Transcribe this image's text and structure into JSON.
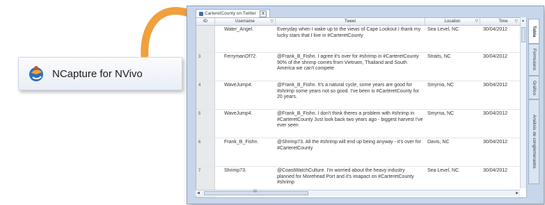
{
  "ncapture": {
    "label": "NCapture for NVivo",
    "icon": "ncapture-logo-icon"
  },
  "window": {
    "tab_title": "CarteretCounty on Twitter",
    "tab_close": "x"
  },
  "grid": {
    "columns": {
      "id": "ID",
      "username": "Username",
      "tweet": "Tweet",
      "location": "Location",
      "time": "Time"
    },
    "filter_glyph": "▽",
    "rows": [
      {
        "num": "",
        "username": "Water_Angel.",
        "tweet": "Everyday when I wake up to the views of Cape Lookout I thank my lucky stars that I live in #CarteretCounty",
        "location": "Sea Level, NC",
        "time": "30/04/2012"
      },
      {
        "num": "3",
        "username": "FerrymanOf72.",
        "tweet": "@Frank_B_Fishn. I agree it's over for #shrimp in #CarteretCounty 90% of the shrimp comes from Vietnam, Thailand and South America we can't compete",
        "location": "Straits, NC",
        "time": "30/04/2012"
      },
      {
        "num": "4",
        "username": "WaveJump4.",
        "tweet": "@Frank_B_Fishn. It's a natural cycle, some years are good for #shrimp some years not so good. I've been is #CarteretCounty for 20 years.",
        "location": "Smyrna, NC",
        "time": "30/04/2012"
      },
      {
        "num": "5",
        "username": "WaveJump4.",
        "tweet": "@Frank_B_Fishn. I don't think theres a problem with #shrimp in #CarteretCounty Just look back two years ago - biggest harvest I've ever seen",
        "location": "Smyrna, NC",
        "time": "30/04/2012"
      },
      {
        "num": "6",
        "username": "Frank_B_Fishn.",
        "tweet": "@Shrimp73. All the #shrimp will end up being anyway - it's over for #CarteretCounty",
        "location": "Davis, NC",
        "time": "30/04/2012"
      },
      {
        "num": "7",
        "username": "Shrimp73.",
        "tweet": "@CoastWatchCulture. I'm worried about the heavy industry planned for Morehead Port and it's imapact on #CarteretCounty #shrimp",
        "location": "Sea Level, NC",
        "time": "30/04/2012"
      }
    ]
  },
  "side_tabs": [
    "Tabla",
    "Formulario",
    "Gráfico",
    "Análisis de conglomerados"
  ],
  "scroll": {
    "hthumb_grip": "III"
  },
  "colors": {
    "arrow": "#f0a03c",
    "accent": "#3f6db3"
  }
}
